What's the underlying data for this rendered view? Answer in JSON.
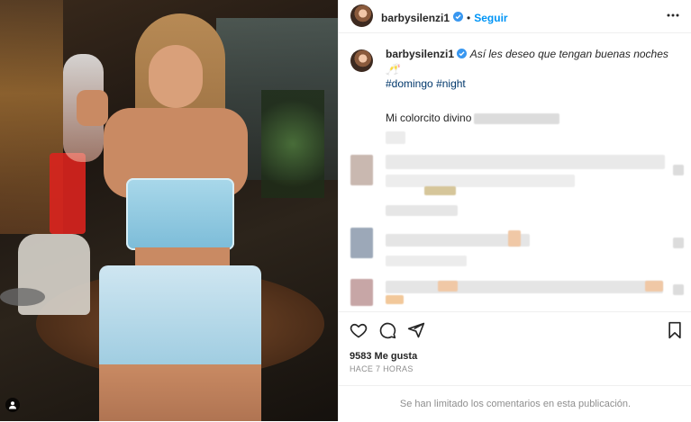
{
  "post": {
    "username": "barbysilenzi1",
    "follow_label": "Seguir",
    "caption_text": "Así les deseo que tengan buenas noches 🥂",
    "hashtags": [
      "#domingo",
      "#night"
    ],
    "visible_comment": "Mi colorcito divino",
    "likes": "9583 Me gusta",
    "time_ago": "HACE 7 HORAS",
    "comments_limited": "Se han limitado los comentarios en esta publicación."
  },
  "icons": {
    "verified": "verified-badge-icon",
    "more": "more-options-icon",
    "like": "heart-icon",
    "comment": "comment-icon",
    "share": "share-icon",
    "save": "bookmark-icon",
    "tagged": "user-tag-icon"
  },
  "colors": {
    "accent": "#0095f6",
    "verified": "#3897f0",
    "text": "#262626",
    "muted": "#8e8e8e"
  }
}
